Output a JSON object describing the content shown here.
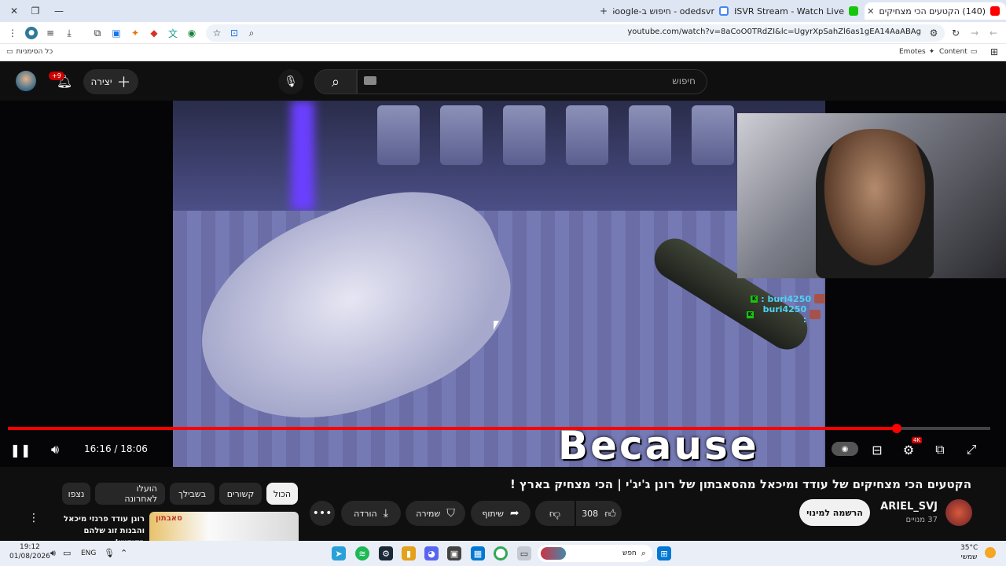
{
  "browser": {
    "tabs": [
      {
        "title": "(140) הקטעים הכי מצחיקים",
        "active": true
      },
      {
        "title": "OdedSVR Stream - Watch Live",
        "active": false
      },
      {
        "title": "odedsvr - חיפוש ב-Google",
        "active": false
      }
    ],
    "new_tab": "+",
    "url": "youtube.com/watch?v=8aCoO0TRdZI&lc=UgyrXpSahZl6as1gEA14AaABAg",
    "bookmarks": {
      "all": "כל הסימניות",
      "content": "Content",
      "emotes": "Emotes"
    }
  },
  "youtube": {
    "search_placeholder": "חיפוש",
    "create_label": "יצירה",
    "notifications_badge": "+9",
    "video": {
      "current_time": "16:16",
      "duration": "18:06",
      "time_display": "16:16 / 18:06",
      "subtitle_text": "Because",
      "progress": 0.905,
      "hd_badge": "4K",
      "chat": [
        {
          "user": "buri4250 :"
        },
        {
          "user": "buri4250 :"
        }
      ]
    },
    "title": "הקטעים הכי מצחיקים של עודד ומיכאל מהסאבתון של רונן ג'יג'י | הכי מצחיק בארץ !",
    "channel": {
      "name": "ARIEL_SVJ",
      "subscribers": "37 מנויים"
    },
    "subscribe_label": "הרשמה למינוי",
    "likes": "308",
    "share_label": "שיתוף",
    "save_label": "שמירה",
    "download_label": "הורדה",
    "chips": [
      "הכול",
      "קשורים",
      "בשבילך",
      "הועלו לאחרונה",
      "נצפו"
    ],
    "recommendation": {
      "title": "רונן עודד פרנזי מיכאל והבנות זוג שלהם בקידוש!...",
      "thumb_text": "סאבתון"
    }
  },
  "taskbar": {
    "time": "19:12",
    "date": "01/08/2026",
    "language": "ENG",
    "search_label": "חפש",
    "weather_temp": "35°C",
    "weather_desc": "שמשי"
  },
  "colors": {
    "accent": "#ff0000",
    "chat_name": "#4fd4f5",
    "chat_badge": "#16c60c"
  }
}
